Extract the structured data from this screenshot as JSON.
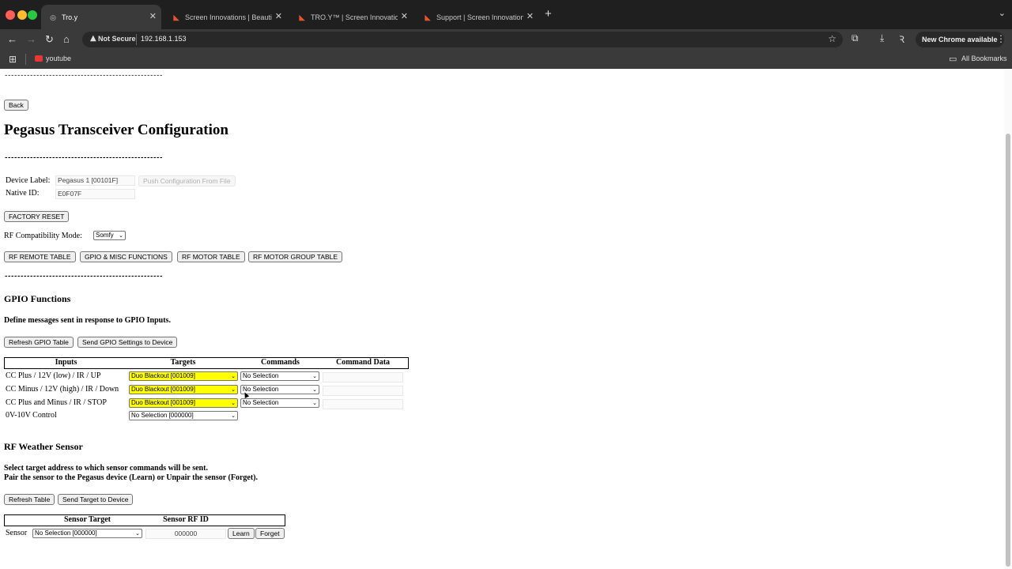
{
  "browser": {
    "tabs": [
      {
        "title": "Tro.y",
        "active": true
      },
      {
        "title": "Screen Innovations | Beautiful"
      },
      {
        "title": "TRO.Y™ | Screen Innovations"
      },
      {
        "title": "Support | Screen Innovations"
      }
    ],
    "security_label": "Not Secure",
    "url": "192.168.1.153",
    "new_chrome_label": "New Chrome available",
    "bookmark_youtube": "youtube",
    "all_bookmarks": "All Bookmarks"
  },
  "page": {
    "top_rule": "--------------------------------------------------",
    "back_button": "Back",
    "title": "Pegasus Transceiver Configuration",
    "rule": "--------------------------------------------------",
    "device_label_label": "Device Label:",
    "device_label_value": "Pegasus 1 [00101F]",
    "push_config_button": "Push Configuration From File",
    "native_id_label": "Native ID:",
    "native_id_value": "E0F07F",
    "factory_reset_button": "FACTORY RESET",
    "rf_mode_label": "RF Compatibility Mode:",
    "rf_mode_value": "Somfy",
    "nav_buttons": [
      "RF REMOTE TABLE",
      "GPIO & MISC FUNCTIONS",
      "RF MOTOR TABLE",
      "RF MOTOR GROUP TABLE"
    ],
    "gpio": {
      "heading": "GPIO Functions",
      "description": "Define messages sent in response to GPIO Inputs.",
      "refresh_button": "Refresh GPIO Table",
      "send_button": "Send GPIO Settings to Device",
      "columns": [
        "Inputs",
        "Targets",
        "Commands",
        "Command Data"
      ],
      "rows": [
        {
          "input": "CC Plus / 12V (low) / IR / UP",
          "target": "Duo Blackout [001009]",
          "command": "No Selection",
          "highlight": true
        },
        {
          "input": "CC Minus / 12V (high) / IR / Down",
          "target": "Duo Blackout [001009]",
          "command": "No Selection",
          "highlight": true
        },
        {
          "input": "CC Plus and Minus / IR / STOP",
          "target": "Duo Blackout [001009]",
          "command": "No Selection",
          "highlight": true
        },
        {
          "input": "0V-10V Control",
          "target": "No Selection [000000]",
          "command": "",
          "highlight": false
        }
      ]
    },
    "weather": {
      "heading": "RF Weather Sensor",
      "description_line1": "Select target address to which sensor commands will be sent.",
      "description_line2": "Pair the sensor to the Pegasus device (Learn) or Unpair the sensor (Forget).",
      "refresh_button": "Refresh Table",
      "send_button": "Send Target to Device",
      "columns": [
        "Sensor Target",
        "Sensor RF ID"
      ],
      "row_label": "Sensor",
      "target_value": "No Selection [000000]",
      "rf_id_value": "000000",
      "learn_button": "Learn",
      "forget_button": "Forget"
    }
  }
}
